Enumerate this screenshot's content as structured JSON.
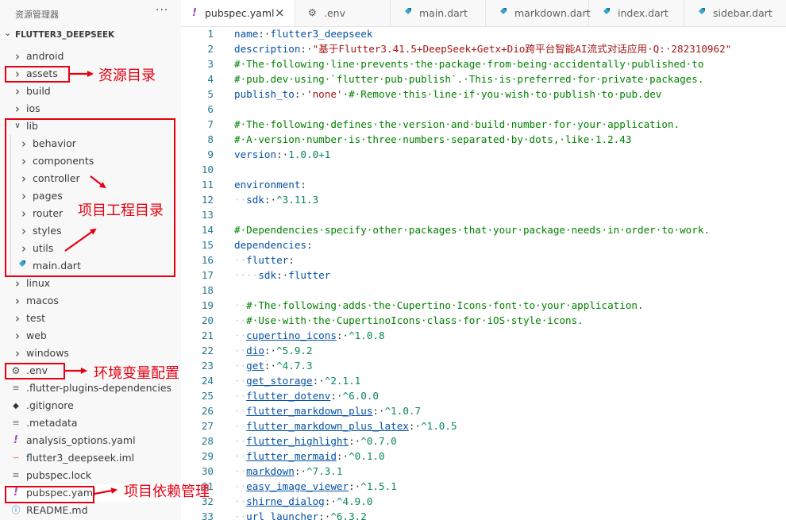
{
  "explorer": {
    "title": "资源管理器",
    "more": "···",
    "project": "FLUTTER3_DEEPSEEK",
    "items": [
      {
        "label": "android",
        "depth": 0,
        "type": "folder",
        "expanded": false
      },
      {
        "label": "assets",
        "depth": 0,
        "type": "folder",
        "expanded": false
      },
      {
        "label": "build",
        "depth": 0,
        "type": "folder",
        "expanded": false
      },
      {
        "label": "ios",
        "depth": 0,
        "type": "folder",
        "expanded": false
      },
      {
        "label": "lib",
        "depth": 0,
        "type": "folder",
        "expanded": true
      },
      {
        "label": "behavior",
        "depth": 1,
        "type": "folder",
        "expanded": false
      },
      {
        "label": "components",
        "depth": 1,
        "type": "folder",
        "expanded": false
      },
      {
        "label": "controller",
        "depth": 1,
        "type": "folder",
        "expanded": false
      },
      {
        "label": "pages",
        "depth": 1,
        "type": "folder",
        "expanded": false
      },
      {
        "label": "router",
        "depth": 1,
        "type": "folder",
        "expanded": false
      },
      {
        "label": "styles",
        "depth": 1,
        "type": "folder",
        "expanded": false
      },
      {
        "label": "utils",
        "depth": 1,
        "type": "folder",
        "expanded": false
      },
      {
        "label": "main.dart",
        "depth": 1,
        "type": "dart"
      },
      {
        "label": "linux",
        "depth": 0,
        "type": "folder",
        "expanded": false
      },
      {
        "label": "macos",
        "depth": 0,
        "type": "folder",
        "expanded": false
      },
      {
        "label": "test",
        "depth": 0,
        "type": "folder",
        "expanded": false
      },
      {
        "label": "web",
        "depth": 0,
        "type": "folder",
        "expanded": false
      },
      {
        "label": "windows",
        "depth": 0,
        "type": "folder",
        "expanded": false
      },
      {
        "label": ".env",
        "depth": 0,
        "type": "gear"
      },
      {
        "label": ".flutter-plugins-dependencies",
        "depth": 0,
        "type": "lines"
      },
      {
        "label": ".gitignore",
        "depth": 0,
        "type": "git"
      },
      {
        "label": ".metadata",
        "depth": 0,
        "type": "lines"
      },
      {
        "label": "analysis_options.yaml",
        "depth": 0,
        "type": "yaml"
      },
      {
        "label": "flutter3_deepseek.iml",
        "depth": 0,
        "type": "rss"
      },
      {
        "label": "pubspec.lock",
        "depth": 0,
        "type": "lines"
      },
      {
        "label": "pubspec.yaml",
        "depth": 0,
        "type": "yaml",
        "selected": true
      },
      {
        "label": "README.md",
        "depth": 0,
        "type": "info"
      }
    ]
  },
  "tabs": [
    {
      "label": "pubspec.yaml",
      "icon": "yaml",
      "active": true,
      "close": "×"
    },
    {
      "label": ".env",
      "icon": "gear"
    },
    {
      "label": "main.dart",
      "icon": "dart"
    },
    {
      "label": "markdown.dart",
      "icon": "dart"
    },
    {
      "label": "index.dart",
      "icon": "dart"
    },
    {
      "label": "sidebar.dart",
      "icon": "dart"
    }
  ],
  "annotations": {
    "assets": "资源目录",
    "lib": "项目工程目录",
    "env": "环境变量配置",
    "pubspec": "项目依赖管理"
  },
  "code": [
    {
      "n": "1",
      "t": [
        [
          "k",
          "name"
        ],
        [
          "p",
          ":·"
        ],
        [
          "s2",
          "flutter3_deepseek"
        ]
      ]
    },
    {
      "n": "2",
      "t": [
        [
          "k",
          "description"
        ],
        [
          "p",
          ":·"
        ],
        [
          "s",
          "\"基于Flutter3.41.5+DeepSeek+Getx+Dio跨平台智能AI流式对话应用·Q:·282310962\""
        ]
      ]
    },
    {
      "n": "3",
      "t": [
        [
          "c",
          "#·The·following·line·prevents·the·package·from·being·accidentally·published·to"
        ]
      ]
    },
    {
      "n": "4",
      "t": [
        [
          "c",
          "#·pub.dev·using·`flutter·pub·publish`.·This·is·preferred·for·private·packages."
        ]
      ]
    },
    {
      "n": "5",
      "t": [
        [
          "k",
          "publish_to"
        ],
        [
          "p",
          ":·"
        ],
        [
          "s",
          "'none'"
        ],
        [
          "p",
          "·"
        ],
        [
          "c",
          "#·Remove·this·line·if·you·wish·to·publish·to·pub.dev"
        ]
      ]
    },
    {
      "n": "6",
      "t": []
    },
    {
      "n": "7",
      "t": [
        [
          "c",
          "#·The·following·defines·the·version·and·build·number·for·your·application."
        ]
      ]
    },
    {
      "n": "8",
      "t": [
        [
          "c",
          "#·A·version·number·is·three·numbers·separated·by·dots,·like·1.2.43"
        ]
      ]
    },
    {
      "n": "9",
      "t": [
        [
          "k",
          "version"
        ],
        [
          "p",
          ":·"
        ],
        [
          "v",
          "1.0.0+1"
        ]
      ]
    },
    {
      "n": "10",
      "t": []
    },
    {
      "n": "11",
      "t": [
        [
          "k",
          "environment"
        ],
        [
          "p",
          ":"
        ]
      ]
    },
    {
      "n": "12",
      "t": [
        [
          "ws",
          "··"
        ],
        [
          "k",
          "sdk"
        ],
        [
          "p",
          ":·"
        ],
        [
          "v",
          "^3.11.3"
        ]
      ]
    },
    {
      "n": "13",
      "t": []
    },
    {
      "n": "14",
      "t": [
        [
          "c",
          "#·Dependencies·specify·other·packages·that·your·package·needs·in·order·to·work."
        ]
      ]
    },
    {
      "n": "15",
      "t": [
        [
          "k",
          "dependencies"
        ],
        [
          "p",
          ":"
        ]
      ]
    },
    {
      "n": "16",
      "t": [
        [
          "ws",
          "··"
        ],
        [
          "k",
          "flutter"
        ],
        [
          "p",
          ":"
        ]
      ]
    },
    {
      "n": "17",
      "t": [
        [
          "ws",
          "····"
        ],
        [
          "k",
          "sdk"
        ],
        [
          "p",
          ":·"
        ],
        [
          "s2",
          "flutter"
        ]
      ]
    },
    {
      "n": "18",
      "t": []
    },
    {
      "n": "19",
      "t": [
        [
          "ws",
          "··"
        ],
        [
          "c",
          "#·The·following·adds·the·Cupertino·Icons·font·to·your·application."
        ]
      ]
    },
    {
      "n": "20",
      "t": [
        [
          "ws",
          "··"
        ],
        [
          "c",
          "#·Use·with·the·CupertinoIcons·class·for·iOS·style·icons."
        ]
      ]
    },
    {
      "n": "21",
      "t": [
        [
          "ws",
          "··"
        ],
        [
          "ku",
          "cupertino_icons"
        ],
        [
          "p",
          ":·"
        ],
        [
          "v",
          "^1.0.8"
        ]
      ]
    },
    {
      "n": "22",
      "t": [
        [
          "ws",
          "··"
        ],
        [
          "ku",
          "dio"
        ],
        [
          "p",
          ":·"
        ],
        [
          "v",
          "^5.9.2"
        ]
      ]
    },
    {
      "n": "23",
      "t": [
        [
          "ws",
          "··"
        ],
        [
          "ku",
          "get"
        ],
        [
          "p",
          ":·"
        ],
        [
          "v",
          "^4.7.3"
        ]
      ]
    },
    {
      "n": "24",
      "t": [
        [
          "ws",
          "··"
        ],
        [
          "ku",
          "get_storage"
        ],
        [
          "p",
          ":·"
        ],
        [
          "v",
          "^2.1.1"
        ]
      ]
    },
    {
      "n": "25",
      "t": [
        [
          "ws",
          "··"
        ],
        [
          "ku",
          "flutter_dotenv"
        ],
        [
          "p",
          ":·"
        ],
        [
          "v",
          "^6.0.0"
        ]
      ]
    },
    {
      "n": "26",
      "t": [
        [
          "ws",
          "··"
        ],
        [
          "ku",
          "flutter_markdown_plus"
        ],
        [
          "p",
          ":·"
        ],
        [
          "v",
          "^1.0.7"
        ]
      ]
    },
    {
      "n": "27",
      "t": [
        [
          "ws",
          "··"
        ],
        [
          "ku",
          "flutter_markdown_plus_latex"
        ],
        [
          "p",
          ":·"
        ],
        [
          "v",
          "^1.0.5"
        ]
      ]
    },
    {
      "n": "28",
      "t": [
        [
          "ws",
          "··"
        ],
        [
          "ku",
          "flutter_highlight"
        ],
        [
          "p",
          ":·"
        ],
        [
          "v",
          "^0.7.0"
        ]
      ]
    },
    {
      "n": "29",
      "t": [
        [
          "ws",
          "··"
        ],
        [
          "ku",
          "flutter_mermaid"
        ],
        [
          "p",
          ":·"
        ],
        [
          "v",
          "^0.1.0"
        ]
      ]
    },
    {
      "n": "30",
      "t": [
        [
          "ws",
          "··"
        ],
        [
          "ku",
          "markdown"
        ],
        [
          "p",
          ":·"
        ],
        [
          "v",
          "^7.3.1"
        ]
      ]
    },
    {
      "n": "31",
      "t": [
        [
          "ws",
          "··"
        ],
        [
          "ku",
          "easy_image_viewer"
        ],
        [
          "p",
          ":·"
        ],
        [
          "v",
          "^1.5.1"
        ]
      ]
    },
    {
      "n": "32",
      "t": [
        [
          "ws",
          "··"
        ],
        [
          "ku",
          "shirne_dialog"
        ],
        [
          "p",
          ":·"
        ],
        [
          "v",
          "^4.9.0"
        ]
      ]
    },
    {
      "n": "33",
      "t": [
        [
          "ws",
          "··"
        ],
        [
          "ku",
          "url_launcher"
        ],
        [
          "p",
          ":·"
        ],
        [
          "v",
          "^6.3.2"
        ]
      ]
    }
  ]
}
